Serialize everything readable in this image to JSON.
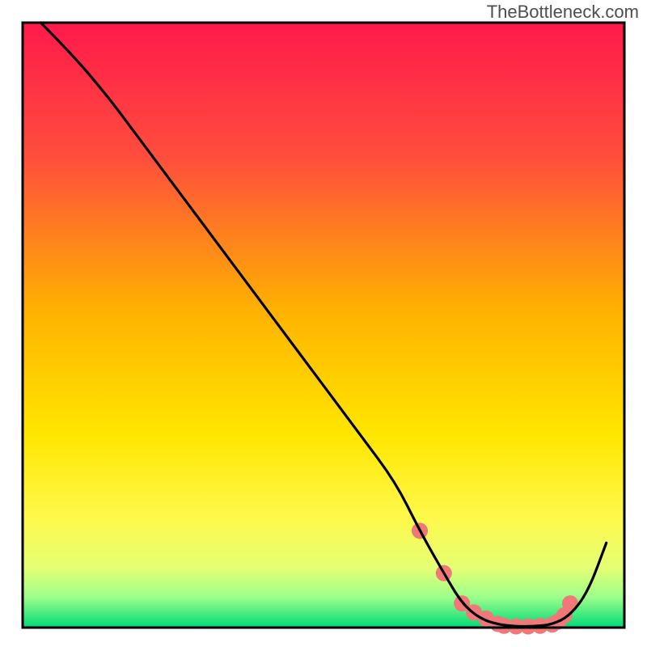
{
  "watermark": "TheBottleneck.com",
  "chart_data": {
    "type": "line",
    "title": "",
    "xlabel": "",
    "ylabel": "",
    "xlim": [
      0,
      100
    ],
    "ylim": [
      0,
      100
    ],
    "grid": false,
    "legend": false,
    "gradient_colors": {
      "top": "#ff1a4b",
      "upper_mid": "#ffea00",
      "lower_mid": "#d7ff59",
      "bottom": "#00d977"
    },
    "series": [
      {
        "name": "bottleneck-curve",
        "color": "#000000",
        "x": [
          3,
          8,
          14,
          20,
          26,
          32,
          38,
          44,
          50,
          56,
          62,
          66,
          70,
          73,
          76,
          79,
          82,
          85,
          88,
          91,
          94,
          97
        ],
        "y": [
          100,
          95,
          88,
          80,
          72,
          64,
          56,
          48,
          40,
          32,
          24,
          16,
          9,
          4,
          1.5,
          0.5,
          0.2,
          0.2,
          0.5,
          2,
          6,
          14
        ]
      }
    ],
    "markers": {
      "name": "optimal-range-markers",
      "color": "#f07878",
      "shape": "circle",
      "radius": 10,
      "x": [
        66,
        70,
        73,
        75,
        77,
        79,
        80,
        82,
        84,
        86,
        88,
        89,
        90,
        91
      ],
      "y": [
        16,
        9,
        4,
        2.5,
        1.5,
        0.6,
        0.3,
        0.2,
        0.2,
        0.3,
        0.5,
        1.0,
        2.0,
        4.0
      ]
    }
  }
}
